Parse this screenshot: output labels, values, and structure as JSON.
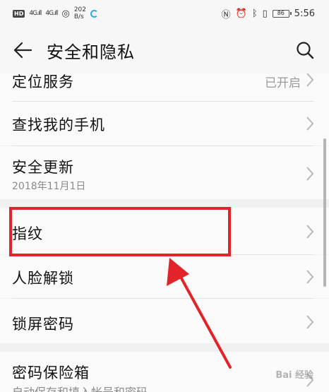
{
  "status_bar": {
    "hd": "HD",
    "signal1": "4G.ıll",
    "signal2": "4G.ıll",
    "speed_value": "202",
    "speed_unit": "B/s",
    "battery": "86",
    "time": "5:56"
  },
  "header": {
    "title": "安全和隐私"
  },
  "items": [
    {
      "label": "定位服务",
      "value": "已开启"
    },
    {
      "label": "查找我的手机"
    },
    {
      "label": "安全更新",
      "sub": "2018年11月1日"
    },
    {
      "label": "指纹"
    },
    {
      "label": "人脸解锁"
    },
    {
      "label": "锁屏密码"
    },
    {
      "label": "密码保险箱",
      "sub": "自动保存和填入帐号和密码"
    }
  ],
  "watermark": "Bai 经验",
  "colors": {
    "highlight": "#e2232a",
    "accent_loading": "#29a9e0"
  }
}
